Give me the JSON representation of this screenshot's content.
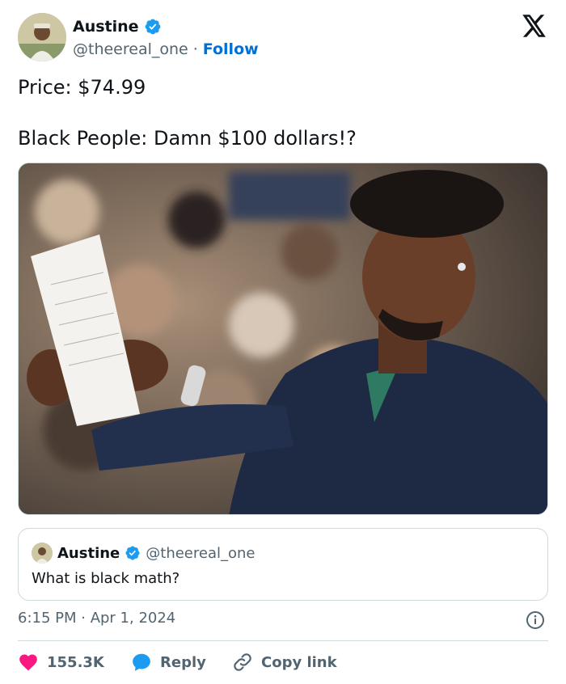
{
  "author": {
    "display_name": "Austine",
    "handle": "@theereal_one",
    "separator": "·",
    "follow_label": "Follow"
  },
  "tweet": {
    "line1": "Price: $74.99",
    "line2": "Black People: Damn $100 dollars!?"
  },
  "quoted": {
    "display_name": "Austine",
    "handle": "@theereal_one",
    "text": "What is black math?"
  },
  "meta": {
    "timestamp": "6:15 PM · Apr 1, 2024"
  },
  "actions": {
    "likes": "155.3K",
    "reply_label": "Reply",
    "copy_link_label": "Copy link"
  },
  "colors": {
    "verified": "#1d9bf0",
    "follow": "#006fd6",
    "heart": "#f91880",
    "secondary_text": "#536471"
  },
  "icons": [
    "verified-badge-icon",
    "x-logo-icon",
    "info-icon",
    "heart-icon",
    "reply-bubble-icon",
    "link-icon"
  ]
}
